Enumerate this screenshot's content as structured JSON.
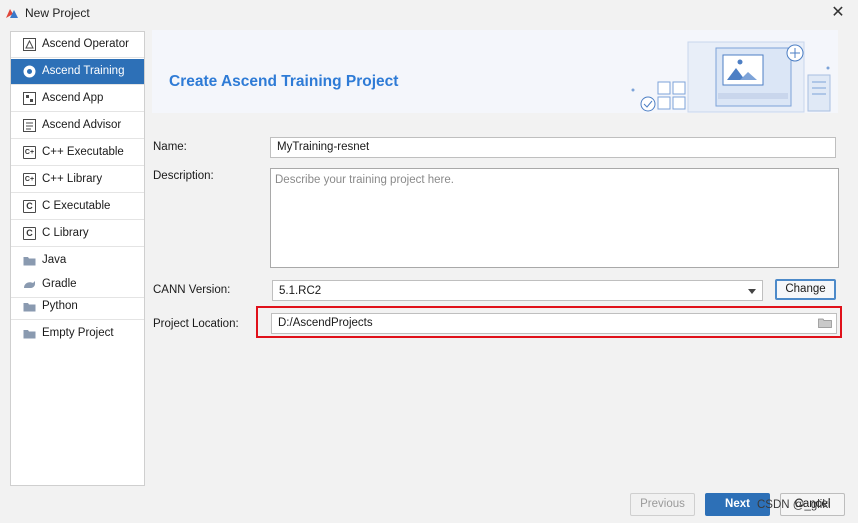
{
  "window": {
    "title": "New Project",
    "close_icon": "close-icon"
  },
  "sidebar": {
    "items": [
      {
        "label": "Ascend Operator",
        "icon": "ascend-operator-icon"
      },
      {
        "label": "Ascend Training",
        "icon": "ascend-training-icon",
        "selected": true
      },
      {
        "label": "Ascend App",
        "icon": "ascend-app-icon"
      },
      {
        "label": "Ascend Advisor",
        "icon": "ascend-advisor-icon"
      },
      {
        "label": "C++ Executable",
        "icon": "cpp-executable-icon"
      },
      {
        "label": "C++ Library",
        "icon": "cpp-library-icon"
      },
      {
        "label": "C Executable",
        "icon": "c-executable-icon"
      },
      {
        "label": "C Library",
        "icon": "c-library-icon"
      },
      {
        "label": "Java",
        "icon": "java-folder-icon"
      },
      {
        "label": "Gradle",
        "icon": "gradle-icon"
      },
      {
        "label": "Python",
        "icon": "python-icon"
      },
      {
        "label": "Empty Project",
        "icon": "empty-project-icon"
      }
    ]
  },
  "banner": {
    "title": "Create Ascend Training Project"
  },
  "form": {
    "name_label": "Name:",
    "name_value": "MyTraining-resnet",
    "description_label": "Description:",
    "description_placeholder": "Describe your training project here.",
    "cann_label": "CANN Version:",
    "cann_value": "5.1.RC2",
    "change_label": "Change",
    "location_label": "Project Location:",
    "location_value": "D:/AscendProjects"
  },
  "footer": {
    "previous_label": "Previous",
    "next_label": "Next",
    "cancel_label": "Cancel",
    "watermark": "CSDN @_gliki"
  },
  "colors": {
    "accent": "#2d70b7",
    "title_blue": "#2e7bd6",
    "highlight_red": "#e0111a"
  }
}
